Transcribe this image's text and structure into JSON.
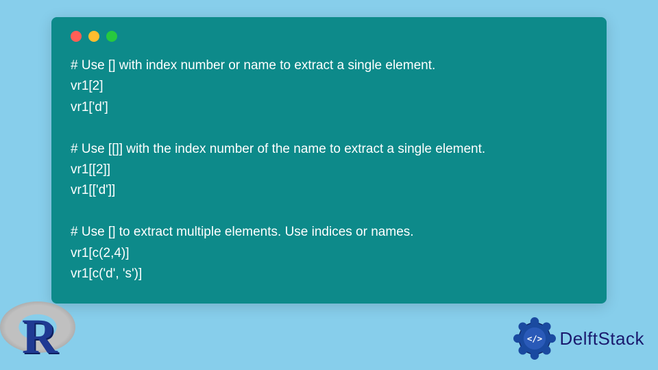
{
  "code": {
    "lines": [
      "# Use [] with index number or name to extract a single element.",
      "vr1[2]",
      "vr1['d']",
      "",
      "# Use [[]] with the index number of the name to extract a single element.",
      "vr1[[2]]",
      "vr1[['d']]",
      "",
      "# Use [] to extract multiple elements. Use indices or names.",
      "vr1[c(2,4)]",
      "vr1[c('d', 's')]"
    ]
  },
  "logos": {
    "left_letter": "R",
    "right_text": "DelftStack",
    "right_badge_code": "</>"
  },
  "colors": {
    "page_bg": "#87ceeb",
    "window_bg": "#0d8a8a",
    "code_text": "#ffffff",
    "brand_blue": "#1a1a6e"
  }
}
